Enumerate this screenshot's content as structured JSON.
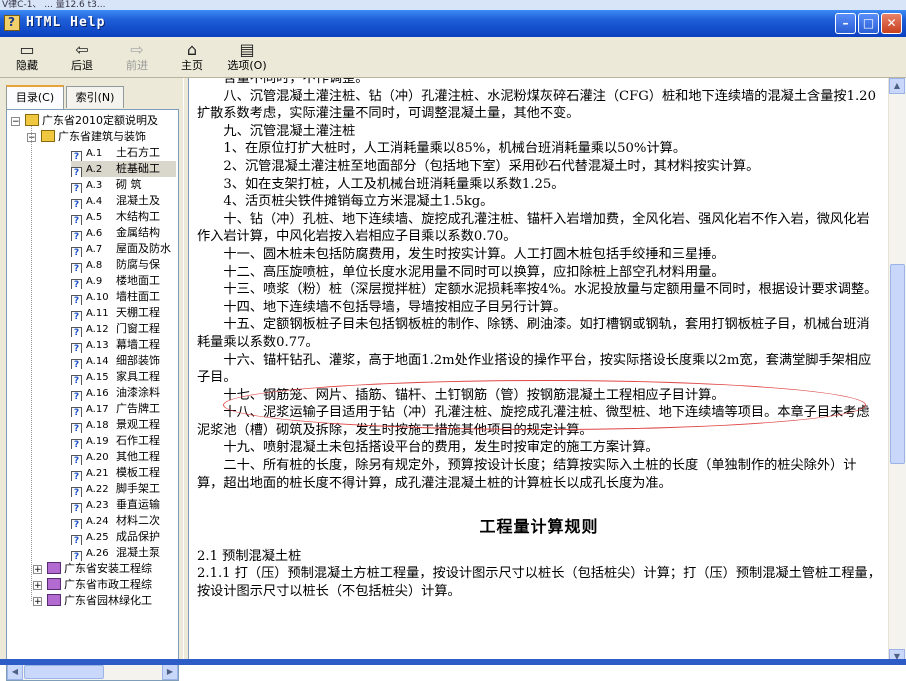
{
  "top_strip_text": "V律C-1、 ... 量12.6 t3...",
  "window": {
    "title": "HTML Help",
    "minimize_glyph": "–",
    "maximize_glyph": "□",
    "close_glyph": "✕"
  },
  "toolbar": {
    "hide_label": "隐藏",
    "back_label": "后退",
    "forward_label": "前进",
    "home_label": "主页",
    "options_label": "选项(O)"
  },
  "tabs": {
    "contents_label": "目录(C)",
    "index_label": "索引(N)"
  },
  "tree": {
    "root_label": "广东省2010定额说明及",
    "book_label": "广东省建筑与装饰",
    "items": [
      {
        "code": "A.1",
        "name": "土石方工"
      },
      {
        "code": "A.2",
        "name": "桩基础工"
      },
      {
        "code": "A.3",
        "name": "砌  筑"
      },
      {
        "code": "A.4",
        "name": "混凝土及"
      },
      {
        "code": "A.5",
        "name": "木结构工"
      },
      {
        "code": "A.6",
        "name": "金属结构"
      },
      {
        "code": "A.7",
        "name": "屋面及防水"
      },
      {
        "code": "A.8",
        "name": "防腐与保"
      },
      {
        "code": "A.9",
        "name": "楼地面工"
      },
      {
        "code": "A.10",
        "name": "墙柱面工"
      },
      {
        "code": "A.11",
        "name": "天棚工程"
      },
      {
        "code": "A.12",
        "name": "门窗工程"
      },
      {
        "code": "A.13",
        "name": "幕墙工程"
      },
      {
        "code": "A.14",
        "name": "细部装饰"
      },
      {
        "code": "A.15",
        "name": "家具工程"
      },
      {
        "code": "A.16",
        "name": "油漆涂料"
      },
      {
        "code": "A.17",
        "name": "广告牌工"
      },
      {
        "code": "A.18",
        "name": "景观工程"
      },
      {
        "code": "A.19",
        "name": "石作工程"
      },
      {
        "code": "A.20",
        "name": "其他工程"
      },
      {
        "code": "A.21",
        "name": "模板工程"
      },
      {
        "code": "A.22",
        "name": "脚手架工"
      },
      {
        "code": "A.23",
        "name": "垂直运输"
      },
      {
        "code": "A.24",
        "name": "材料二次"
      },
      {
        "code": "A.25",
        "name": "成品保护"
      },
      {
        "code": "A.26",
        "name": "混凝土泵"
      }
    ],
    "other_books": [
      "广东省安装工程综",
      "广东省市政工程综",
      "广东省园林绿化工"
    ]
  },
  "content": {
    "partial_top": "含量不同时，不作调整。",
    "paragraphs": [
      "八、沉管混凝土灌注桩、钻（冲）孔灌注桩、水泥粉煤灰碎石灌注（CFG）桩和地下连续墙的混凝土含量按1.20扩散系数考虑，实际灌注量不同时，可调整混凝土量，其他不变。",
      "九、沉管混凝土灌注桩",
      "1、在原位打扩大桩时，人工消耗量乘以85%，机械台班消耗量乘以50%计算。",
      "2、沉管混凝土灌注桩至地面部分（包括地下室）采用砂石代替混凝土时，其材料按实计算。",
      "3、如在支架打桩，人工及机械台班消耗量乘以系数1.25。",
      "4、活页桩尖铁件摊销每立方米混凝土1.5kg。",
      "十、钻（冲）孔桩、地下连续墙、旋挖成孔灌注桩、锚杆入岩增加费，全风化岩、强风化岩不作入岩，微风化岩作入岩计算，中风化岩按入岩相应子目乘以系数0.70。",
      "十一、圆木桩未包括防腐费用，发生时按实计算。人工打圆木桩包括手绞捶和三星捶。",
      "十二、高压旋喷桩，单位长度水泥用量不同时可以换算，应扣除桩上部空孔材料用量。",
      "十三、喷浆（粉）桩（深层搅拌桩）定额水泥损耗率按4%。水泥投放量与定额用量不同时，根据设计要求调整。",
      "十四、地下连续墙不包括导墙，导墙按相应子目另行计算。",
      "十五、定额钢板桩子目未包括钢板桩的制作、除锈、刷油漆。如打槽钢或钢轨，套用打钢板桩子目，机械台班消耗量乘以系数0.77。",
      "十六、锚杆钻孔、灌浆，高于地面1.2m处作业搭设的操作平台，按实际搭设长度乘以2m宽，套满堂脚手架相应子目。",
      "十七、钢筋笼、网片、插筋、锚杆、土钉钢筋（管）按钢筋混凝土工程相应子目计算。",
      "十八、泥浆运输子目适用于钻（冲）孔灌注桩、旋挖成孔灌注桩、微型桩、地下连续墙等项目。本章子目未考虑泥浆池（槽）砌筑及拆除，发生时按施工措施其他项目的规定计算。",
      "十九、喷射混凝土未包括搭设平台的费用，发生时按审定的施工方案计算。",
      "二十、所有桩的长度，除另有规定外，预算按设计长度；结算按实际入土桩的长度（单独制作的桩尖除外）计算，超出地面的桩长度不得计算，成孔灌注混凝土桩的计算桩长以成孔长度为准。"
    ],
    "heading": "工程量计算规则",
    "rule_section": "2.1  预制混凝土桩",
    "rule_item": "2.1.1  打（压）预制混凝土方桩工程量，按设计图示尺寸以桩长（包括桩尖）计算；打（压）预制混凝土管桩工程量，按设计图示尺寸以桩长（不包括桩尖）计算。"
  },
  "annotation_color": "#e04545"
}
